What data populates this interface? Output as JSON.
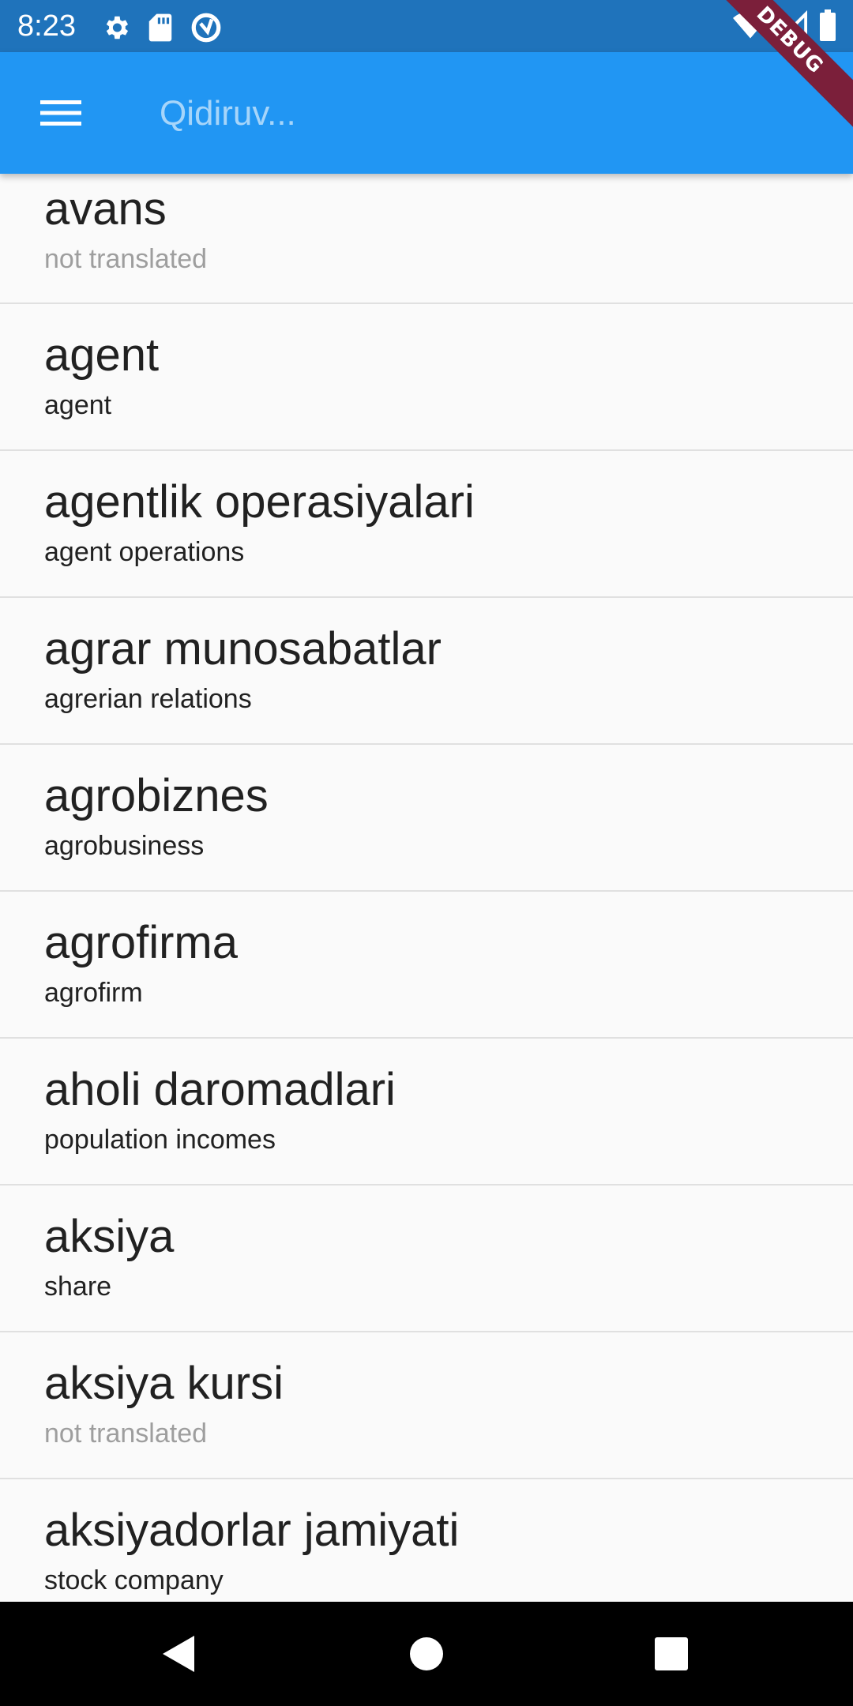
{
  "status_bar": {
    "time": "8:23",
    "left_icons": [
      "gear-icon",
      "sd-card-icon",
      "data-saver-icon"
    ],
    "right_icons": [
      "wifi-icon",
      "signal-icon",
      "battery-icon"
    ]
  },
  "debug_banner": "DEBUG",
  "app_bar": {
    "menu_icon": "hamburger-menu-icon",
    "search_placeholder": "Qidiruv..."
  },
  "words": [
    {
      "term": "avans",
      "translation": "not translated",
      "translated": false
    },
    {
      "term": "agent",
      "translation": "agent",
      "translated": true
    },
    {
      "term": "agentlik operasiyalari",
      "translation": "agent operations",
      "translated": true
    },
    {
      "term": "agrar munosabatlar",
      "translation": "agrerian relations",
      "translated": true
    },
    {
      "term": "agrobiznes",
      "translation": "agrobusiness",
      "translated": true
    },
    {
      "term": "agrofirma",
      "translation": "agrofirm",
      "translated": true
    },
    {
      "term": "aholi daromadlari",
      "translation": "population incomes",
      "translated": true
    },
    {
      "term": "aksiya",
      "translation": "share",
      "translated": true
    },
    {
      "term": "aksiya kursi",
      "translation": "not translated",
      "translated": false
    },
    {
      "term": "aksiyadorlar jamiyati",
      "translation": "stock company",
      "translated": true
    }
  ],
  "nav_bar": [
    "back-icon",
    "home-icon",
    "recents-icon"
  ],
  "colors": {
    "status_bar": "#1f73bb",
    "app_bar": "#2196f3",
    "background": "#fafafa",
    "untranslated_text": "#9e9e9e",
    "debug_banner": "#7b1f3a"
  }
}
